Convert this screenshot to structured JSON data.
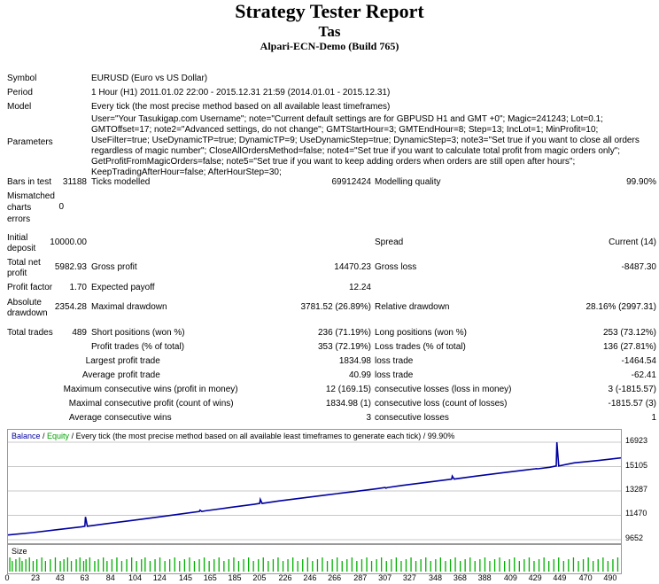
{
  "header": {
    "title": "Strategy Tester Report",
    "ea_name": "Tas",
    "server": "Alpari-ECN-Demo (Build 765)"
  },
  "summary": {
    "symbol_label": "Symbol",
    "symbol_value": "EURUSD (Euro vs US Dollar)",
    "period_label": "Period",
    "period_value": "1 Hour (H1) 2011.01.02 22:00 - 2015.12.31 21:59 (2014.01.01 - 2015.12.31)",
    "model_label": "Model",
    "model_value": "Every tick (the most precise method based on all available least timeframes)",
    "parameters_label": "Parameters",
    "parameters_value": "User=\"Your Tasukigap.com Username\"; note=\"Current default settings are for GBPUSD H1 and GMT +0\"; Magic=241243; Lot=0.1; GMTOffset=17; note2=\"Advanced settings, do not change\"; GMTStartHour=3; GMTEndHour=8; Step=13; IncLot=1; MinProfit=10; UseFilter=true; UseDynamicTP=true; DynamicTP=9; UseDynamicStep=true; DynamicStep=3; note3=\"Set true if you want to close all orders regardless of magic number\"; CloseAllOrdersMethod=false; note4=\"Set true if you want to calculate total profit from magic orders only\"; GetProfitFromMagicOrders=false; note5=\"Set true if you want to keep adding orders when orders are still open after hours\"; KeepTradingAfterHour=false; AfterHourStep=30;",
    "bars_label": "Bars in test",
    "bars_value": "31188",
    "ticks_label": "Ticks modelled",
    "ticks_value": "69912424",
    "quality_label": "Modelling quality",
    "quality_value": "99.90%",
    "mismatch_label": "Mismatched charts errors",
    "mismatch_value": "0",
    "deposit_label": "Initial deposit",
    "deposit_value": "10000.00",
    "spread_label": "Spread",
    "spread_value": "Current (14)",
    "netprofit_label": "Total net profit",
    "netprofit_value": "5982.93",
    "grossprofit_label": "Gross profit",
    "grossprofit_value": "14470.23",
    "grossloss_label": "Gross loss",
    "grossloss_value": "-8487.30",
    "pf_label": "Profit factor",
    "pf_value": "1.70",
    "payoff_label": "Expected payoff",
    "payoff_value": "12.24",
    "absdd_label": "Absolute drawdown",
    "absdd_value": "2354.28",
    "maxdd_label": "Maximal drawdown",
    "maxdd_value": "3781.52 (26.89%)",
    "reldd_label": "Relative drawdown",
    "reldd_value": "28.16% (2997.31)",
    "trades_label": "Total trades",
    "trades_value": "489",
    "short_label": "Short positions (won %)",
    "short_value": "236 (71.19%)",
    "long_label": "Long positions (won %)",
    "long_value": "253 (73.12%)",
    "ptrades_label": "Profit trades (% of total)",
    "ptrades_value": "353 (72.19%)",
    "ltrades_label": "Loss trades (% of total)",
    "ltrades_value": "136 (27.81%)",
    "largest_label": "Largest",
    "lprofit_label": "profit trade",
    "lprofit_value": "1834.98",
    "lloss_label": "loss trade",
    "lloss_value": "-1464.54",
    "average_label": "Average",
    "aprofit_label": "profit trade",
    "aprofit_value": "40.99",
    "aloss_label": "loss trade",
    "aloss_value": "-62.41",
    "maximum_label": "Maximum",
    "mcw_label": "consecutive wins (profit in money)",
    "mcw_value": "12 (169.15)",
    "mcl_label": "consecutive losses (loss in money)",
    "mcl_value": "3 (-1815.57)",
    "maximal_label": "Maximal",
    "mcp_label": "consecutive profit (count of wins)",
    "mcp_value": "1834.98 (1)",
    "mclo_label": "consecutive loss (count of losses)",
    "mclo_value": "-1815.57 (3)",
    "average2_label": "Average",
    "acw_label": "consecutive wins",
    "acw_value": "3",
    "acl_label": "consecutive losses",
    "acl_value": "1"
  },
  "chart_legend": {
    "balance": "Balance",
    "sep": " / ",
    "equity": "Equity",
    "rest": " / Every tick (the most precise method based on all available least timeframes to generate each tick) / 99.90%",
    "size_label": "Size"
  },
  "colors": {
    "balance": "#0000a0",
    "equity": "#00a000",
    "size_bars": "#00b000",
    "grid": "#c8c8c8"
  },
  "chart_data": {
    "type": "line",
    "y_ticks": [
      "16923",
      "15105",
      "13287",
      "11470",
      "9652"
    ],
    "ylim": [
      9652,
      16923
    ],
    "x_ticks": [
      "0",
      "23",
      "43",
      "63",
      "84",
      "104",
      "124",
      "145",
      "165",
      "185",
      "205",
      "226",
      "246",
      "266",
      "287",
      "307",
      "327",
      "348",
      "368",
      "388",
      "409",
      "429",
      "449",
      "470",
      "490"
    ],
    "xlim": [
      0,
      498
    ],
    "series": [
      {
        "name": "Balance",
        "x": [
          0,
          20,
          40,
          60,
          80,
          100,
          120,
          140,
          160,
          180,
          200,
          220,
          240,
          260,
          280,
          300,
          320,
          340,
          360,
          380,
          400,
          420,
          440,
          460,
          480,
          498
        ],
        "values": [
          10000,
          10180,
          10400,
          10620,
          10850,
          11080,
          11320,
          11560,
          11800,
          12050,
          12290,
          12540,
          12770,
          13000,
          13230,
          13460,
          13700,
          13930,
          14160,
          14390,
          14620,
          14850,
          15050,
          15380,
          15560,
          15750
        ]
      }
    ],
    "spikes": [
      {
        "x": 63,
        "value": 11350
      },
      {
        "x": 156,
        "value": 11850
      },
      {
        "x": 205,
        "value": 12650
      },
      {
        "x": 307,
        "value": 13500
      },
      {
        "x": 361,
        "value": 14400
      },
      {
        "x": 429,
        "value": 14950
      },
      {
        "x": 446,
        "value": 16923
      }
    ],
    "size_bars": [
      1,
      3,
      6,
      9,
      11,
      14,
      17,
      20,
      23,
      27,
      30,
      34,
      38,
      42,
      45,
      48,
      51,
      55,
      58,
      61,
      63,
      66,
      70,
      73,
      77,
      80,
      84,
      88,
      92,
      96,
      100,
      104,
      108,
      111,
      115,
      119,
      123,
      127,
      131,
      135,
      139,
      143,
      147,
      151,
      155,
      159,
      163,
      167,
      171,
      175,
      179,
      183,
      187,
      191,
      195,
      199,
      203,
      207,
      211,
      215,
      219,
      223,
      227,
      231,
      235,
      239,
      243,
      247,
      251,
      255,
      259,
      263,
      267,
      271,
      275,
      279,
      283,
      287,
      291,
      295,
      299,
      303,
      307,
      311,
      315,
      319,
      323,
      327,
      331,
      335,
      339,
      343,
      347,
      351,
      355,
      359,
      363,
      367,
      371,
      375,
      379,
      383,
      387,
      391,
      395,
      399,
      403,
      407,
      411,
      415,
      419,
      423,
      427,
      431,
      435,
      439,
      443,
      447,
      451,
      455,
      459,
      463,
      467,
      471,
      475,
      479,
      483,
      487,
      491,
      495
    ]
  }
}
